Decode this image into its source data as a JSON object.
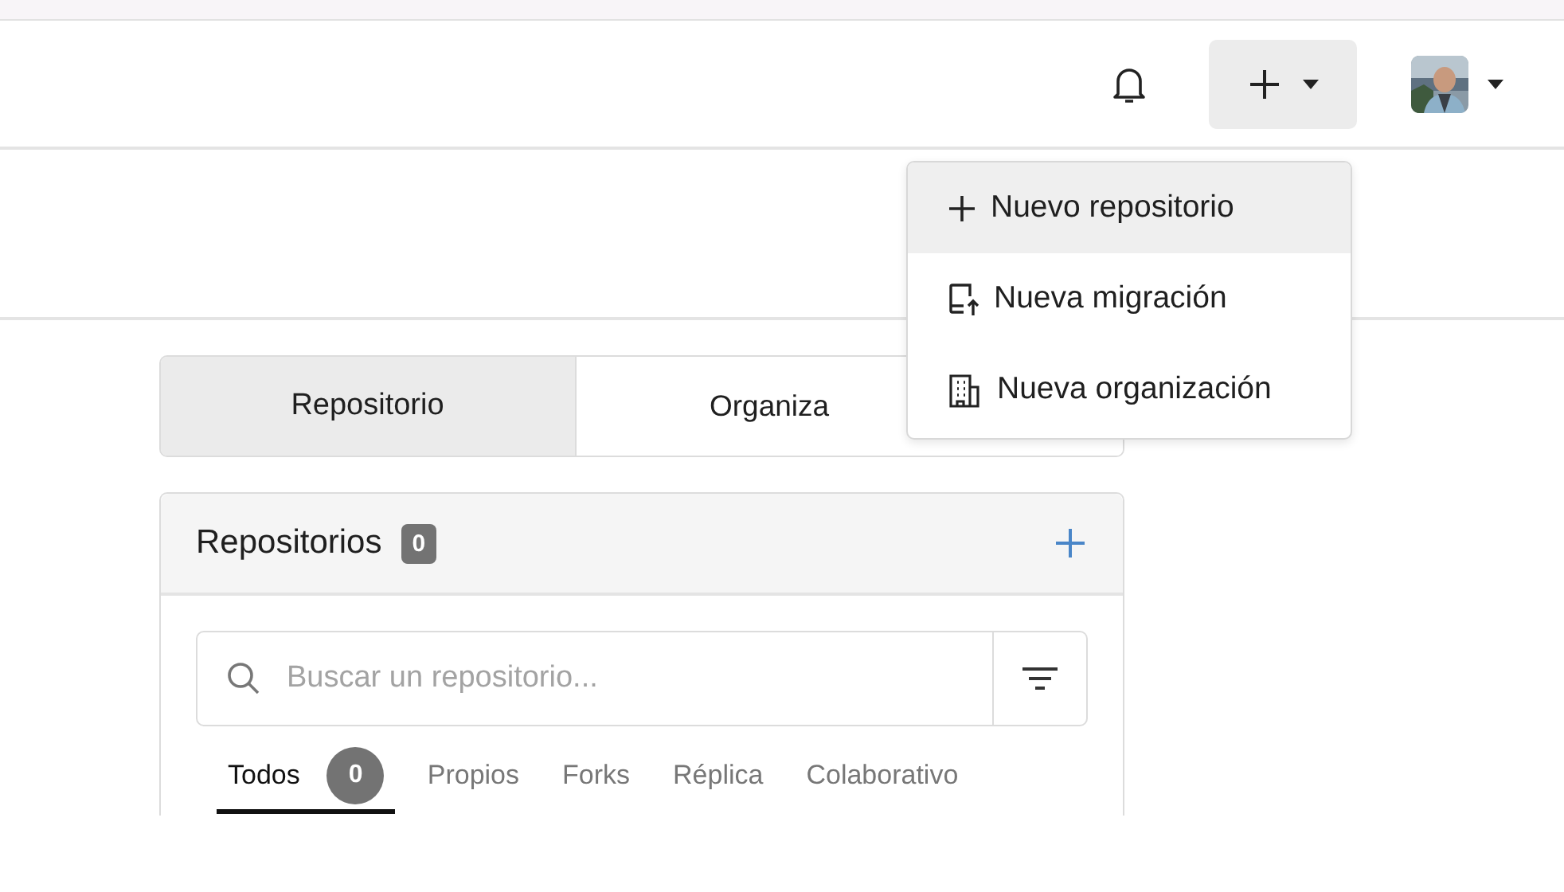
{
  "header": {
    "create_menu": {
      "expanded": true,
      "items": [
        {
          "kind": "plus",
          "label": "Nuevo repositorio",
          "selected": true
        },
        {
          "kind": "migration",
          "label": "Nueva migración",
          "selected": false
        },
        {
          "kind": "organization",
          "label": "Nueva organización",
          "selected": false
        }
      ]
    }
  },
  "view_tabs": [
    {
      "label": "Repositorio",
      "selected": true
    },
    {
      "label": "Organiza",
      "selected": false
    }
  ],
  "repositories": {
    "title": "Repositorios",
    "count": "0",
    "search": {
      "placeholder": "Buscar un repositorio..."
    },
    "filters": [
      {
        "label": "Todos",
        "count": "0",
        "selected": true
      },
      {
        "label": "Propios",
        "selected": false
      },
      {
        "label": "Forks",
        "selected": false
      },
      {
        "label": "Réplica",
        "selected": false
      },
      {
        "label": "Colaborativo",
        "selected": false
      }
    ]
  }
}
